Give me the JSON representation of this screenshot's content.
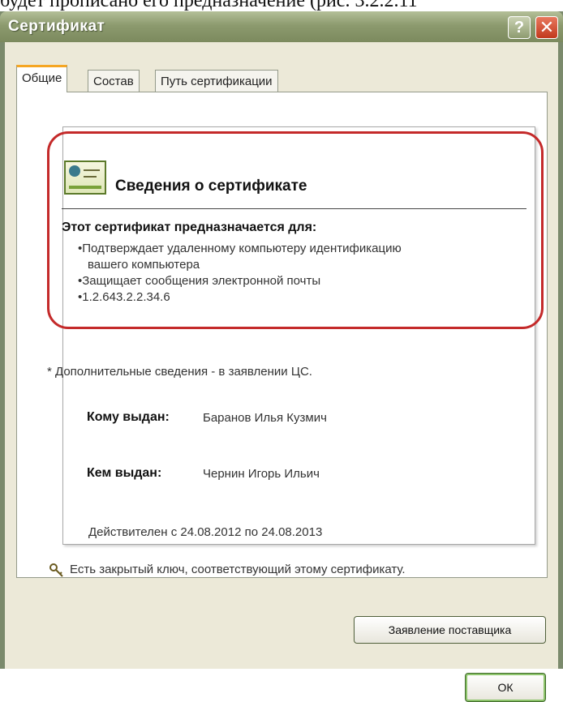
{
  "document_text": "будет прописано его предназначение (рис. 3.2.2.11",
  "window": {
    "title": "Сертификат",
    "help_glyph": "?",
    "close_glyph": "✕"
  },
  "tabs": [
    {
      "label": "Общие",
      "selected": true
    },
    {
      "label": "Состав",
      "selected": false
    },
    {
      "label": "Путь сертификации",
      "selected": false
    }
  ],
  "info": {
    "title": "Сведения о сертификате",
    "purpose_heading": "Этот сертификат предназначается для:",
    "purposes": [
      "•Подтверждает удаленному компьютеру идентификацию",
      "вашего компьютера",
      "•Защищает сообщения электронной почты",
      "•1.2.643.2.2.34.6"
    ],
    "note": "* Дополнительные сведения - в заявлении ЦС.",
    "issued_to_label": "Кому выдан:",
    "issued_to_value": "Баранов Илья Кузмич",
    "issued_by_label": "Кем выдан:",
    "issued_by_value": "Чернин Игорь Ильич",
    "validity": "Действителен с 24.08.2012 по 24.08.2013",
    "key_note": "Есть закрытый ключ, соответствующий этому сертификату."
  },
  "buttons": {
    "issuer_statement": "Заявление поставщика",
    "ok": "ОК"
  },
  "colors": {
    "titlebar": "#8c9a6e",
    "highlight": "#c42a2a",
    "active_tab_accent": "#f5a623"
  },
  "icons": [
    "certificate-icon",
    "key-icon",
    "help-icon",
    "close-icon"
  ]
}
